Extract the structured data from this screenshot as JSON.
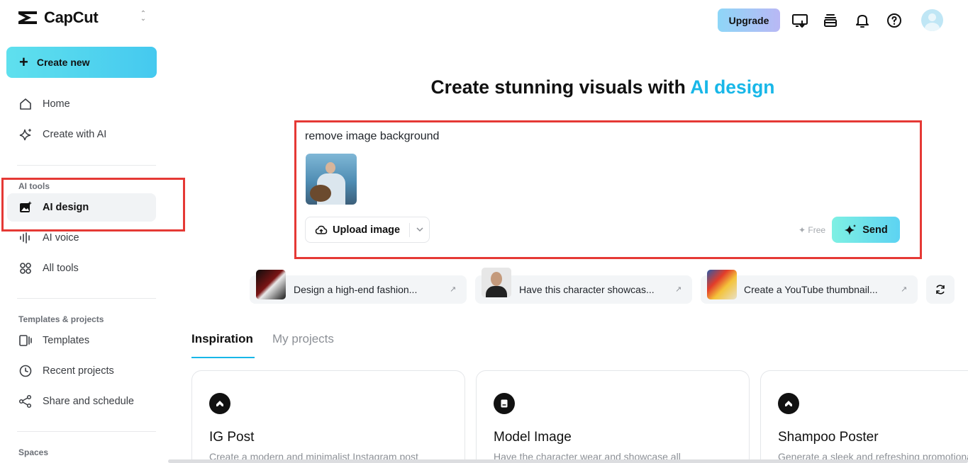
{
  "app": {
    "name": "CapCut"
  },
  "sidebar": {
    "create_label": "Create new",
    "items_top": [
      {
        "label": "Home",
        "icon": "home-icon"
      },
      {
        "label": "Create with AI",
        "icon": "sparkle-icon"
      }
    ],
    "ai_tools_title": "AI tools",
    "ai_tools": [
      {
        "label": "AI design",
        "icon": "image-sparkle-icon",
        "active": true
      },
      {
        "label": "AI voice",
        "icon": "waveform-icon"
      },
      {
        "label": "All tools",
        "icon": "grid-icon"
      }
    ],
    "templates_title": "Templates & projects",
    "templates": [
      {
        "label": "Templates",
        "icon": "template-icon"
      },
      {
        "label": "Recent projects",
        "icon": "clock-icon"
      },
      {
        "label": "Share and schedule",
        "icon": "share-icon"
      }
    ],
    "spaces_title": "Spaces"
  },
  "header": {
    "upgrade_label": "Upgrade",
    "icons": [
      "download-screen-icon",
      "inbox-stack-icon",
      "bell-icon",
      "help-icon",
      "avatar"
    ]
  },
  "main": {
    "headline_prefix": "Create stunning visuals with ",
    "headline_accent": "AI design",
    "prompt": {
      "value": "remove image background",
      "upload_label": "Upload image",
      "free_label": "✦ Free",
      "send_label": "Send"
    },
    "suggestions": [
      {
        "label": "Design a high-end fashion..."
      },
      {
        "label": "Have this character showcas..."
      },
      {
        "label": "Create a YouTube thumbnail..."
      }
    ],
    "tabs": [
      {
        "label": "Inspiration",
        "active": true
      },
      {
        "label": "My projects",
        "active": false
      }
    ],
    "cards": [
      {
        "title": "IG Post",
        "desc": "Create a modern and minimalist Instagram post"
      },
      {
        "title": "Model Image",
        "desc": "Have the character wear and showcase all"
      },
      {
        "title": "Shampoo Poster",
        "desc": "Generate a sleek and refreshing promotional"
      }
    ]
  },
  "colors": {
    "accent": "#18b7e8",
    "highlight_box": "#e53935"
  }
}
